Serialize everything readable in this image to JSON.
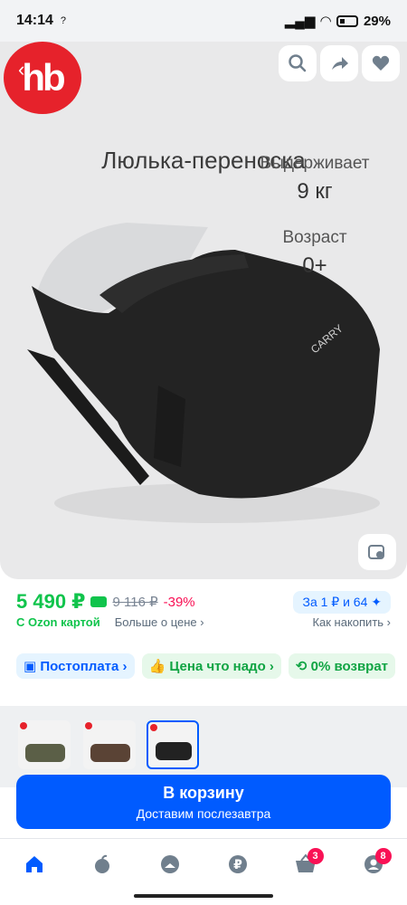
{
  "status": {
    "time": "14:14",
    "sim": "?",
    "battery": "29%"
  },
  "product": {
    "logo": "hb",
    "title": "Люлька-переноска",
    "spec1": {
      "label": "Выдерживает",
      "value": "9 кг"
    },
    "spec2": {
      "label": "Возраст",
      "value": "0+"
    },
    "brand_on_item": "CARRY"
  },
  "pricing": {
    "price": "5 490 ₽",
    "old_price": "9 116 ₽",
    "discount": "-39%",
    "bonus": "За 1 ₽ и 64",
    "ozon_card": "С Ozon картой",
    "more_price": "Больше о цене",
    "how_accumulate": "Как накопить"
  },
  "chips": [
    {
      "label": "Постоплата"
    },
    {
      "label": "Цена что надо"
    },
    {
      "label": "0% возврат"
    }
  ],
  "cart": {
    "main": "В корзину",
    "sub": "Доставим послезавтра"
  },
  "nav": {
    "cart_badge": "3",
    "profile_badge": "8"
  },
  "colors": {
    "accent": "#005bff",
    "price": "#10c44c",
    "discount": "#f91155",
    "logo": "#e6222b"
  }
}
